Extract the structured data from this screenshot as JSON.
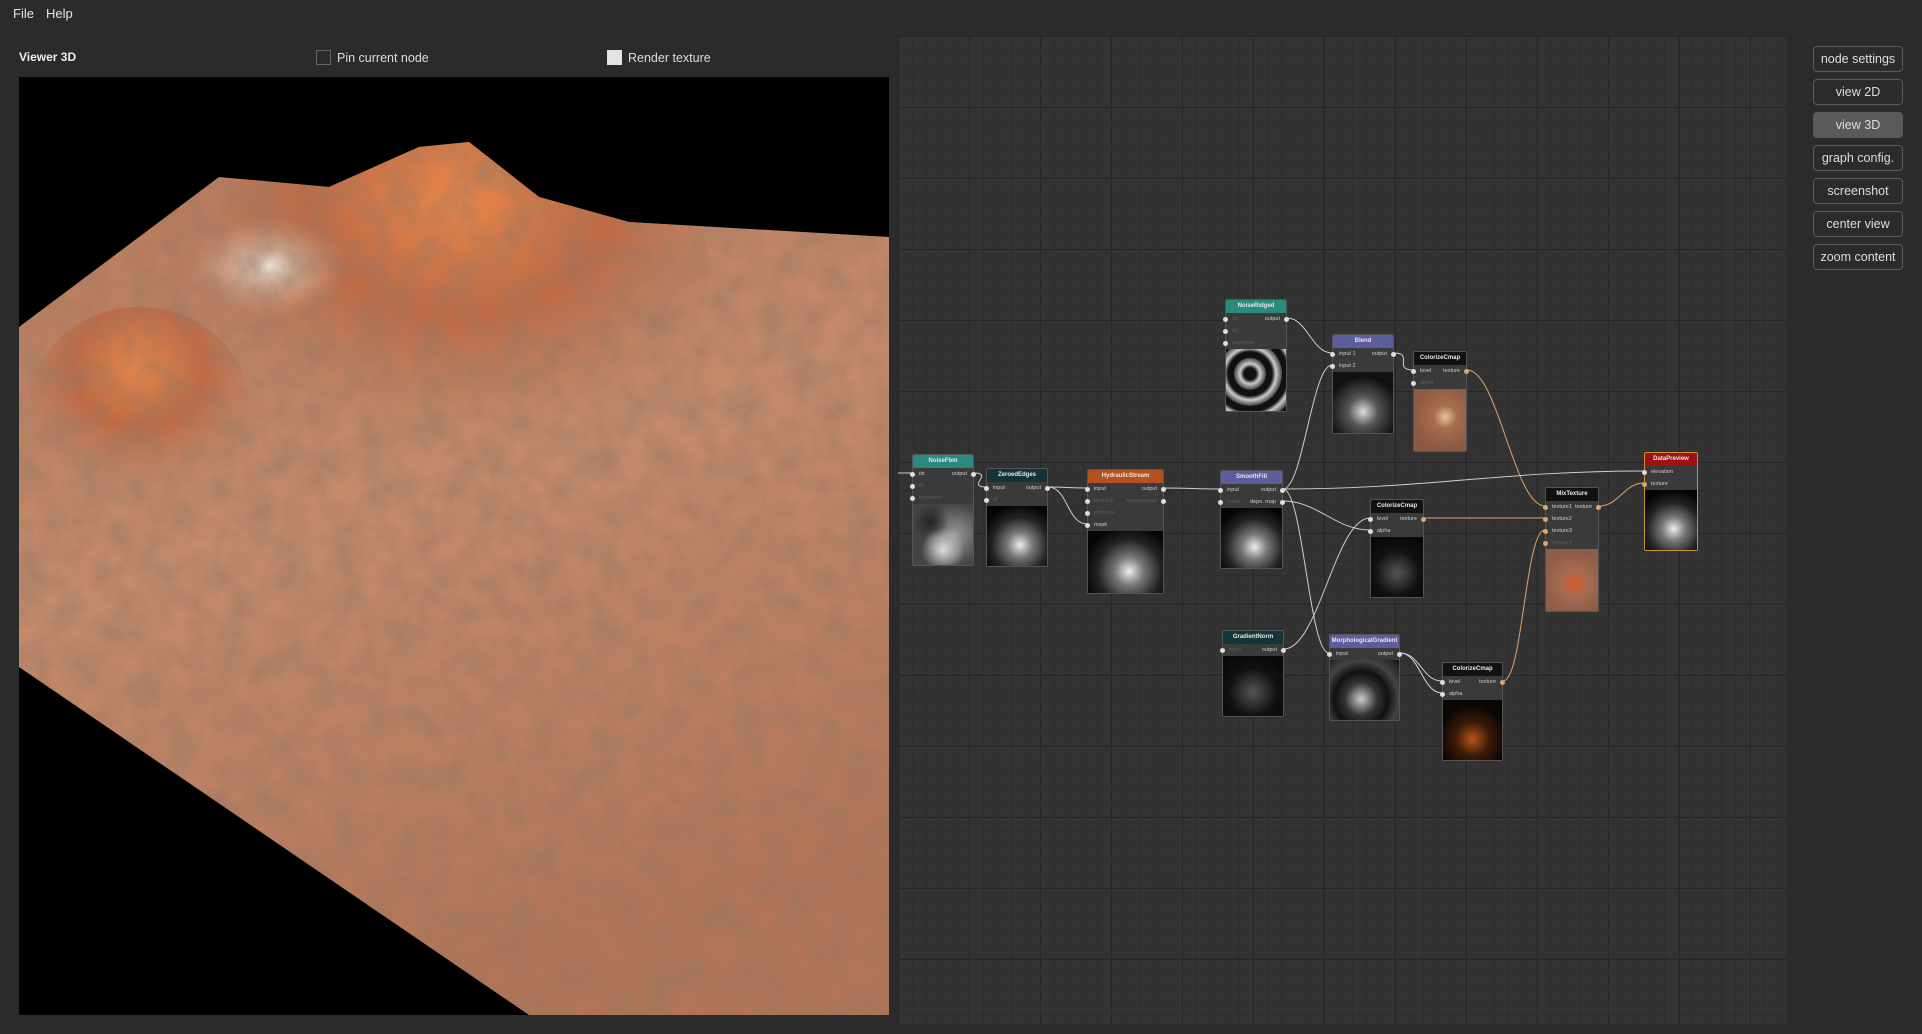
{
  "menu": [
    {
      "label": "File"
    },
    {
      "label": "Help"
    }
  ],
  "viewer": {
    "title": "Viewer 3D",
    "pin_label": "Pin current node",
    "pin_checked": false,
    "render_label": "Render texture",
    "render_checked": true
  },
  "buttons": [
    {
      "label": "node settings"
    },
    {
      "label": "view 2D"
    },
    {
      "label": "view 3D",
      "active": true
    },
    {
      "label": "graph config."
    },
    {
      "label": "screenshot"
    },
    {
      "label": "center view"
    },
    {
      "label": "zoom content"
    }
  ],
  "colors": {
    "accent_texture_wire": "#e3a468",
    "wire": "#cfcfcf",
    "node_noise": "#2a8a80",
    "node_dark": "#12343a",
    "node_erosion": "#b5501f",
    "node_filter": "#5c5c9e",
    "node_colorize": "#111111",
    "node_preview": "#a01212"
  },
  "graph": {
    "nodes": [
      {
        "id": "fbm",
        "title": "NoiseFbm",
        "color": "#2a8a80",
        "inputs": [
          {
            "n": "dx",
            "on": true
          },
          {
            "n": "dy",
            "on": false
          },
          {
            "n": "envelope",
            "on": false
          }
        ],
        "outputs": [
          {
            "n": "output"
          }
        ],
        "thumb": "noise"
      },
      {
        "id": "zero",
        "title": "ZeroedEdges",
        "color": "#12343a",
        "inputs": [
          {
            "n": "input",
            "on": true
          },
          {
            "n": "dr",
            "on": false
          }
        ],
        "outputs": [
          {
            "n": "output"
          }
        ],
        "thumb": "blob"
      },
      {
        "id": "hyd",
        "title": "HydraulicStream",
        "color": "#b5501f",
        "inputs": [
          {
            "n": "input",
            "on": true
          },
          {
            "n": "bedrock",
            "on": false
          },
          {
            "n": "moisture",
            "on": false
          },
          {
            "n": "mask",
            "on": true
          }
        ],
        "outputs": [
          {
            "n": "output"
          },
          {
            "n": "erosion map",
            "on": false
          }
        ],
        "thumb": "blob"
      },
      {
        "id": "smooth",
        "title": "SmoothFill",
        "color": "#5c5c9e",
        "inputs": [
          {
            "n": "input",
            "on": true
          },
          {
            "n": "mask",
            "on": false
          }
        ],
        "outputs": [
          {
            "n": "output"
          },
          {
            "n": "depo. map"
          }
        ],
        "thumb": "blob"
      },
      {
        "id": "ridged",
        "title": "NoiseRidged",
        "color": "#2a8a80",
        "inputs": [
          {
            "n": "dx",
            "on": false
          },
          {
            "n": "dy",
            "on": false
          },
          {
            "n": "envelope",
            "on": false
          }
        ],
        "outputs": [
          {
            "n": "output"
          }
        ],
        "thumb": "ridged"
      },
      {
        "id": "blend",
        "title": "Blend",
        "color": "#5c5c9e",
        "inputs": [
          {
            "n": "input 1",
            "on": true
          },
          {
            "n": "input 2",
            "on": true
          }
        ],
        "outputs": [
          {
            "n": "output"
          }
        ],
        "thumb": "blend"
      },
      {
        "id": "cc1",
        "title": "ColorizeCmap",
        "color": "#111111",
        "inputs": [
          {
            "n": "level",
            "on": true
          },
          {
            "n": "alpha",
            "on": false
          }
        ],
        "outputs": [
          {
            "n": "texture",
            "tex": true
          }
        ],
        "thumb": "tan"
      },
      {
        "id": "cc2",
        "title": "ColorizeCmap",
        "color": "#111111",
        "inputs": [
          {
            "n": "level",
            "on": true
          },
          {
            "n": "alpha",
            "on": true
          }
        ],
        "outputs": [
          {
            "n": "texture",
            "tex": true
          }
        ],
        "thumb": "speck"
      },
      {
        "id": "mix",
        "title": "MixTexture",
        "color": "#111111",
        "inputs": [
          {
            "n": "texture1",
            "on": true,
            "tex": true
          },
          {
            "n": "texture2",
            "on": true,
            "tex": true
          },
          {
            "n": "texture3",
            "on": true,
            "tex": true
          },
          {
            "n": "texture4",
            "on": false,
            "tex": true
          }
        ],
        "outputs": [
          {
            "n": "texture",
            "tex": true
          }
        ],
        "thumb": "mix"
      },
      {
        "id": "prev",
        "title": "DataPreview",
        "color": "#a01212",
        "inputs": [
          {
            "n": "elevation",
            "on": true
          },
          {
            "n": "texture",
            "on": true,
            "tex": true
          }
        ],
        "outputs": [],
        "thumb": "blob",
        "selected": true
      },
      {
        "id": "gn",
        "title": "GradientNorm",
        "color": "#12343a",
        "inputs": [
          {
            "n": "input",
            "on": false
          }
        ],
        "outputs": [
          {
            "n": "output"
          }
        ],
        "thumb": "speck"
      },
      {
        "id": "mg",
        "title": "MorphologicalGradient",
        "color": "#5c5c9e",
        "inputs": [
          {
            "n": "input",
            "on": true
          }
        ],
        "outputs": [
          {
            "n": "output"
          }
        ],
        "thumb": "morph"
      },
      {
        "id": "cc3",
        "title": "ColorizeCmap",
        "color": "#111111",
        "inputs": [
          {
            "n": "level",
            "on": true
          },
          {
            "n": "alpha",
            "on": true
          }
        ],
        "outputs": [
          {
            "n": "texture",
            "tex": true
          }
        ],
        "thumb": "ember"
      }
    ],
    "links": [
      [
        "fbm.output",
        "zero.input"
      ],
      [
        "zero.output",
        "hyd.input"
      ],
      [
        "zero.output",
        "hyd.mask"
      ],
      [
        "hyd.output",
        "smooth.input"
      ],
      [
        "ridged.output",
        "blend.input 1"
      ],
      [
        "smooth.output",
        "blend.input 2"
      ],
      [
        "blend.output",
        "cc1.level"
      ],
      [
        "smooth.output",
        "prev.elevation"
      ],
      [
        "smooth.depo. map",
        "cc2.alpha"
      ],
      [
        "gn.output",
        "cc2.level"
      ],
      [
        "smooth.output",
        "mg.input"
      ],
      [
        "mg.output",
        "cc3.level"
      ],
      [
        "mg.output",
        "cc3.alpha"
      ],
      [
        "cc1.texture",
        "mix.texture1"
      ],
      [
        "cc2.texture",
        "mix.texture2"
      ],
      [
        "cc3.texture",
        "mix.texture3"
      ],
      [
        "mix.texture",
        "prev.texture"
      ]
    ]
  }
}
